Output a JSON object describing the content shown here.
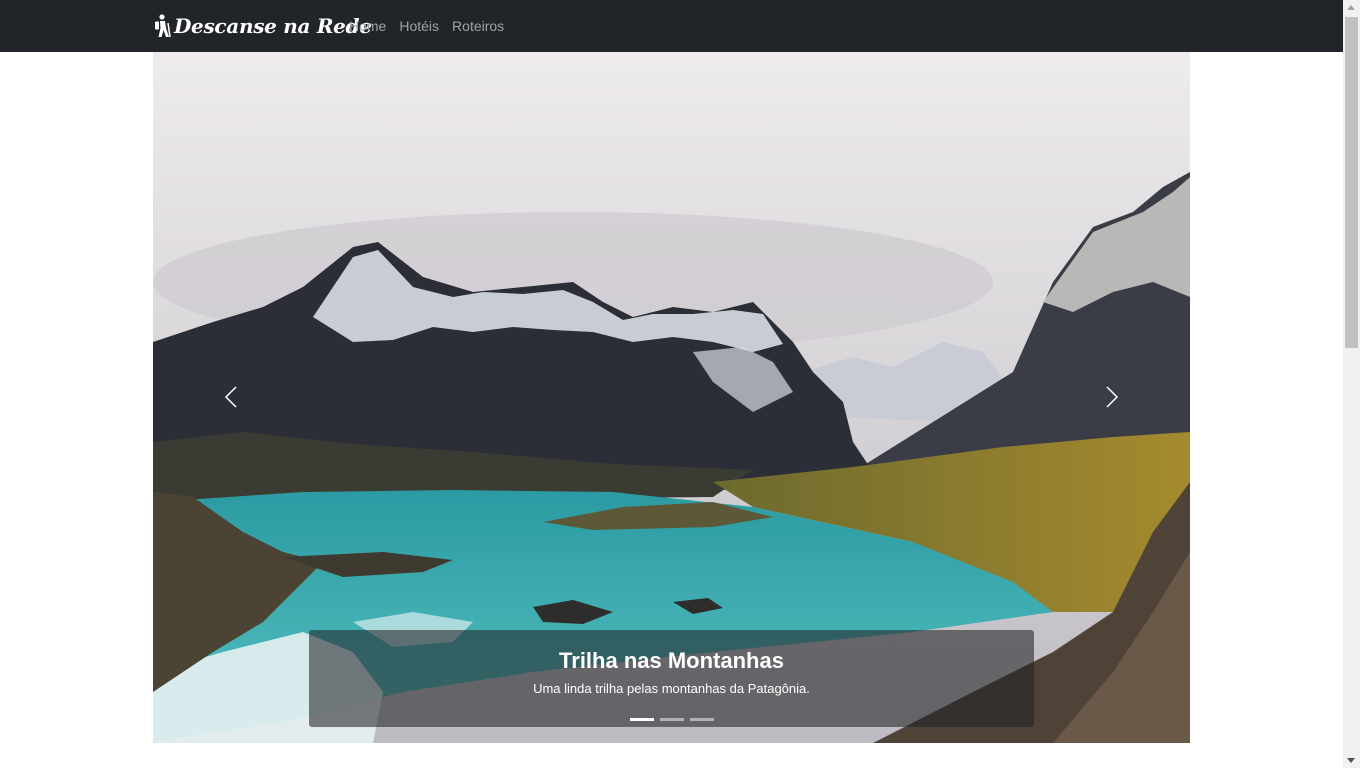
{
  "navbar": {
    "brand": "Descanse na Rede",
    "links": [
      "Home",
      "Hotéis",
      "Roteiros"
    ]
  },
  "carousel": {
    "slide": {
      "title": "Trilha nas Montanhas",
      "description": "Uma linda trilha pelas montanhas da Patagônia."
    },
    "indicator_count": 3,
    "active_index": 0
  },
  "icons": {
    "brand": "hiking-icon",
    "prev": "chevron-left-icon",
    "next": "chevron-right-icon"
  },
  "colors": {
    "navbar_bg": "#212529",
    "nav_link": "#9ea2a7",
    "lake": "#2aa3a6"
  }
}
